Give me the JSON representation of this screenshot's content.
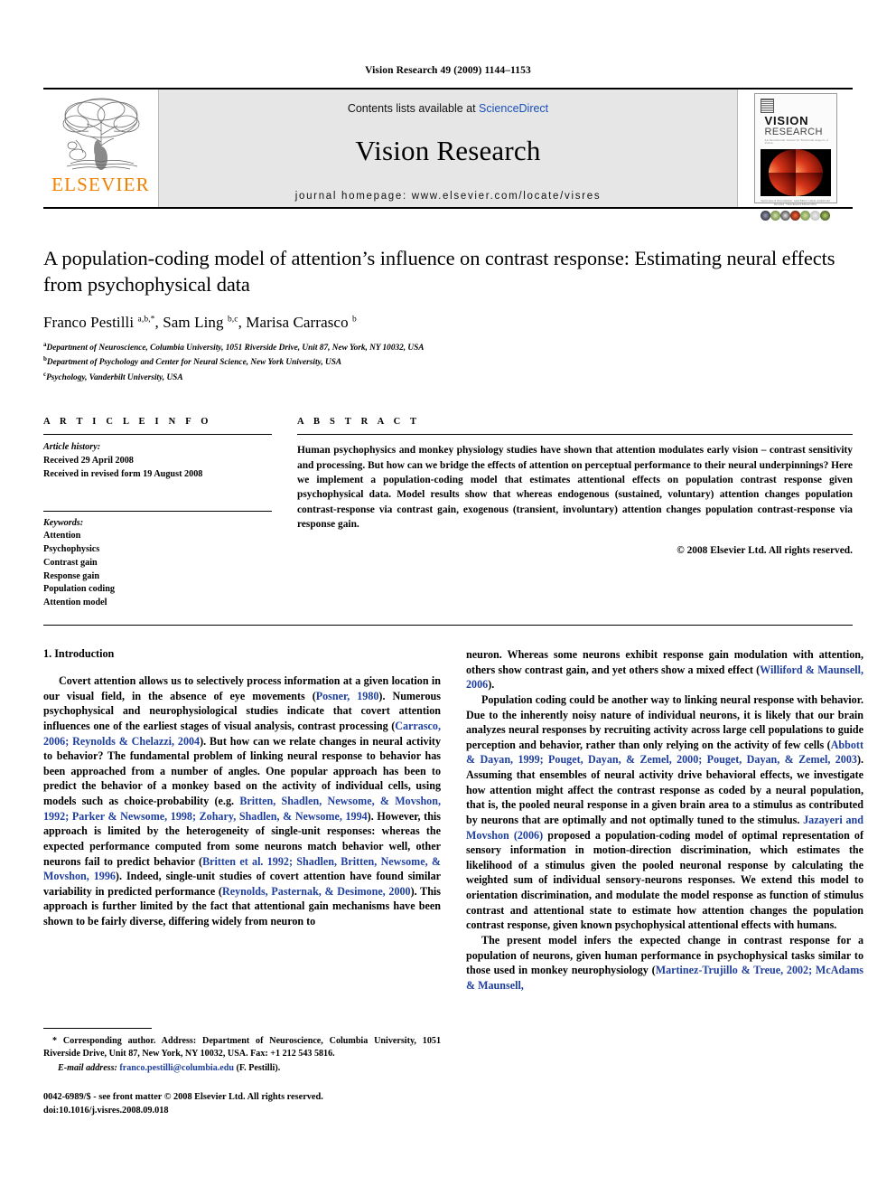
{
  "running_head": "Vision Research 49 (2009) 1144–1153",
  "masthead": {
    "publisher_name": "ELSEVIER",
    "contents_prefix": "Contents lists available at ",
    "sciencedirect_link": "ScienceDirect",
    "journal_name": "Vision Research",
    "homepage_line": "journal homepage: www.elsevier.com/locate/visres",
    "cover": {
      "title_line1": "VISION",
      "title_line2": "RESEARCH",
      "subtitle": "An International Journal for Functional Aspects of Vision",
      "caption": "Special Issue on Visual Attention · Guest Editors: Contrast, Attention and Perception · Vision Research Editorial Office"
    }
  },
  "article": {
    "title": "A population-coding model of attention’s influence on contrast response: Estimating neural effects from psychophysical data",
    "authors_html": "Franco Pestilli <sup>a,b,*</sup>, Sam Ling <sup>b,c</sup>, Marisa Carrasco <sup>b</sup>",
    "affiliations": [
      {
        "marker": "a",
        "text": "Department of Neuroscience, Columbia University, 1051 Riverside Drive, Unit 87, New York, NY 10032, USA"
      },
      {
        "marker": "b",
        "text": "Department of Psychology and Center for Neural Science, New York University, USA"
      },
      {
        "marker": "c",
        "text": "Psychology, Vanderbilt University, USA"
      }
    ]
  },
  "article_info": {
    "heading": "A R T I C L E    I N F O",
    "history_label": "Article history:",
    "history_lines": [
      "Received 29 April 2008",
      "Received in revised form 19 August 2008"
    ],
    "keywords_label": "Keywords:",
    "keywords": [
      "Attention",
      "Psychophysics",
      "Contrast gain",
      "Response gain",
      "Population coding",
      "Attention model"
    ]
  },
  "abstract": {
    "heading": "A B S T R A C T",
    "text": "Human psychophysics and monkey physiology studies have shown that attention modulates early vision – contrast sensitivity and processing. But how can we bridge the effects of attention on perceptual performance to their neural underpinnings? Here we implement a population-coding model that estimates attentional effects on population contrast response given psychophysical data. Model results show that whereas endogenous (sustained, voluntary) attention changes population contrast-response via contrast gain, exogenous (transient, involuntary) attention changes population contrast-response via response gain.",
    "copyright": "© 2008 Elsevier Ltd. All rights reserved."
  },
  "body": {
    "section_title": "1. Introduction",
    "left_paragraphs": [
      "Covert attention allows us to selectively process information at a given location in our visual field, in the absence of eye movements (<span class=\"cite\">Posner, 1980</span>). Numerous psychophysical and neurophysiological studies indicate that covert attention influences one of the earliest stages of visual analysis, contrast processing (<span class=\"cite\">Carrasco, 2006; Reynolds &amp; Chelazzi, 2004</span>). But how can we relate changes in neural activity to behavior? The fundamental problem of linking neural response to behavior has been approached from a number of angles. One popular approach has been to predict the behavior of a monkey based on the activity of individual cells, using models such as choice-probability (e.g. <span class=\"cite\">Britten, Shadlen, Newsome, &amp; Movshon, 1992; Parker &amp; Newsome, 1998; Zohary, Shadlen, &amp; Newsome, 1994</span>). However, this approach is limited by the heterogeneity of single-unit responses: whereas the expected performance computed from some neurons match behavior well, other neurons fail to predict behavior (<span class=\"cite\">Britten et al. 1992; Shadlen, Britten, Newsome, &amp; Movshon, 1996</span>). Indeed, single-unit studies of covert attention have found similar variability in predicted performance (<span class=\"cite\">Reynolds, Pasternak, &amp; Desimone, 2000</span>). This approach is further limited by the fact that attentional gain mechanisms have been shown to be fairly diverse, differing widely from neuron to"
    ],
    "right_paragraphs": [
      "neuron. Whereas some neurons exhibit response gain modulation with attention, others show contrast gain, and yet others show a mixed effect (<span class=\"cite\">Williford &amp; Maunsell, 2006</span>).",
      "Population coding could be another way to linking neural response with behavior. Due to the inherently noisy nature of individual neurons, it is likely that our brain analyzes neural responses by recruiting activity across large cell populations to guide perception and behavior, rather than only relying on the activity of few cells (<span class=\"cite\">Abbott &amp; Dayan, 1999; Pouget, Dayan, &amp; Zemel, 2000; Pouget, Dayan, &amp; Zemel, 2003</span>). Assuming that ensembles of neural activity drive behavioral effects, we investigate how attention might affect the contrast response as coded by a neural population, that is, the pooled neural response in a given brain area to a stimulus as contributed by neurons that are optimally and not optimally tuned to the stimulus. <span class=\"cite\">Jazayeri and Movshon (2006)</span> proposed a population-coding model of optimal representation of sensory information in motion-direction discrimination, which estimates the likelihood of a stimulus given the pooled neuronal response by calculating the weighted sum of individual sensory-neurons responses. We extend this model to orientation discrimination, and modulate the model response as function of stimulus contrast and attentional state to estimate how attention changes the population contrast response, given known psychophysical attentional effects with humans.",
      "The present model infers the expected change in contrast response for a population of neurons, given human performance in psychophysical tasks similar to those used in monkey neurophysiology (<span class=\"cite\">Martinez-Trujillo &amp; Treue, 2002; McAdams &amp; Maunsell,</span>"
    ]
  },
  "footnotes": {
    "corresponding": "* Corresponding author. Address: Department of Neuroscience, Columbia University, 1051 Riverside Drive, Unit 87, New York, NY 10032, USA. Fax: +1 212 543 5816.",
    "email_label": "E-mail address:",
    "email": "franco.pestilli@columbia.edu",
    "email_suffix": "(F. Pestilli).",
    "issn_line": "0042-6989/$ - see front matter © 2008 Elsevier Ltd. All rights reserved.",
    "doi_line": "doi:10.1016/j.visres.2008.09.018"
  },
  "colors": {
    "link_blue": "#1a4fbb",
    "citation_blue": "#1f3f9e",
    "elsevier_orange": "#F08000",
    "masthead_gray": "#e6e6e6"
  }
}
